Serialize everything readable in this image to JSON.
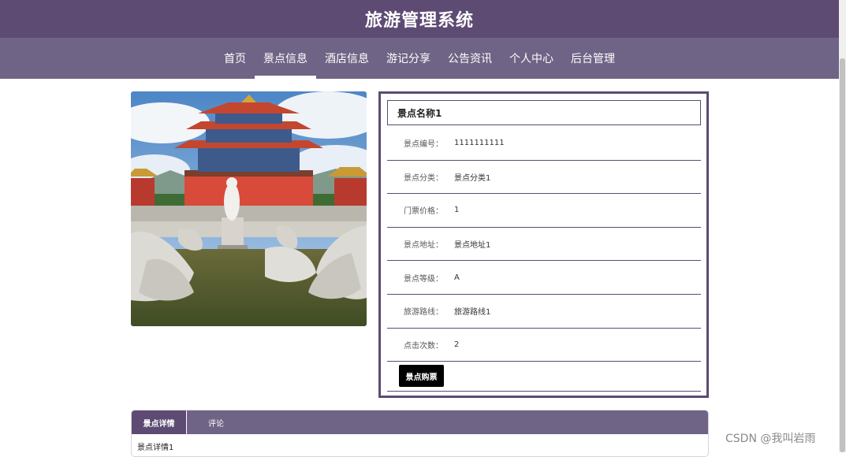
{
  "header": {
    "site_title": "旅游管理系统"
  },
  "nav": {
    "items": [
      {
        "label": "首页",
        "active": false
      },
      {
        "label": "景点信息",
        "active": true
      },
      {
        "label": "酒店信息",
        "active": false
      },
      {
        "label": "游记分享",
        "active": false
      },
      {
        "label": "公告资讯",
        "active": false
      },
      {
        "label": "个人中心",
        "active": false
      },
      {
        "label": "后台管理",
        "active": false
      }
    ]
  },
  "detail": {
    "name": "景点名称1",
    "fields": [
      {
        "label": "景点编号：",
        "value": "1111111111"
      },
      {
        "label": "景点分类：",
        "value": "景点分类1"
      },
      {
        "label": "门票价格：",
        "value": "1"
      },
      {
        "label": "景点地址：",
        "value": "景点地址1"
      },
      {
        "label": "景点等级：",
        "value": "A"
      },
      {
        "label": "旅游路线：",
        "value": "旅游路线1"
      },
      {
        "label": "点击次数：",
        "value": "2"
      }
    ],
    "buy_label": "景点购票"
  },
  "tabs": {
    "items": [
      {
        "label": "景点详情",
        "active": true
      },
      {
        "label": "评论",
        "active": false
      }
    ],
    "content": "景点详情1"
  },
  "watermark": "CSDN @我叫岩雨",
  "colors": {
    "primary": "#5d4b73",
    "nav": "#6f6485"
  }
}
